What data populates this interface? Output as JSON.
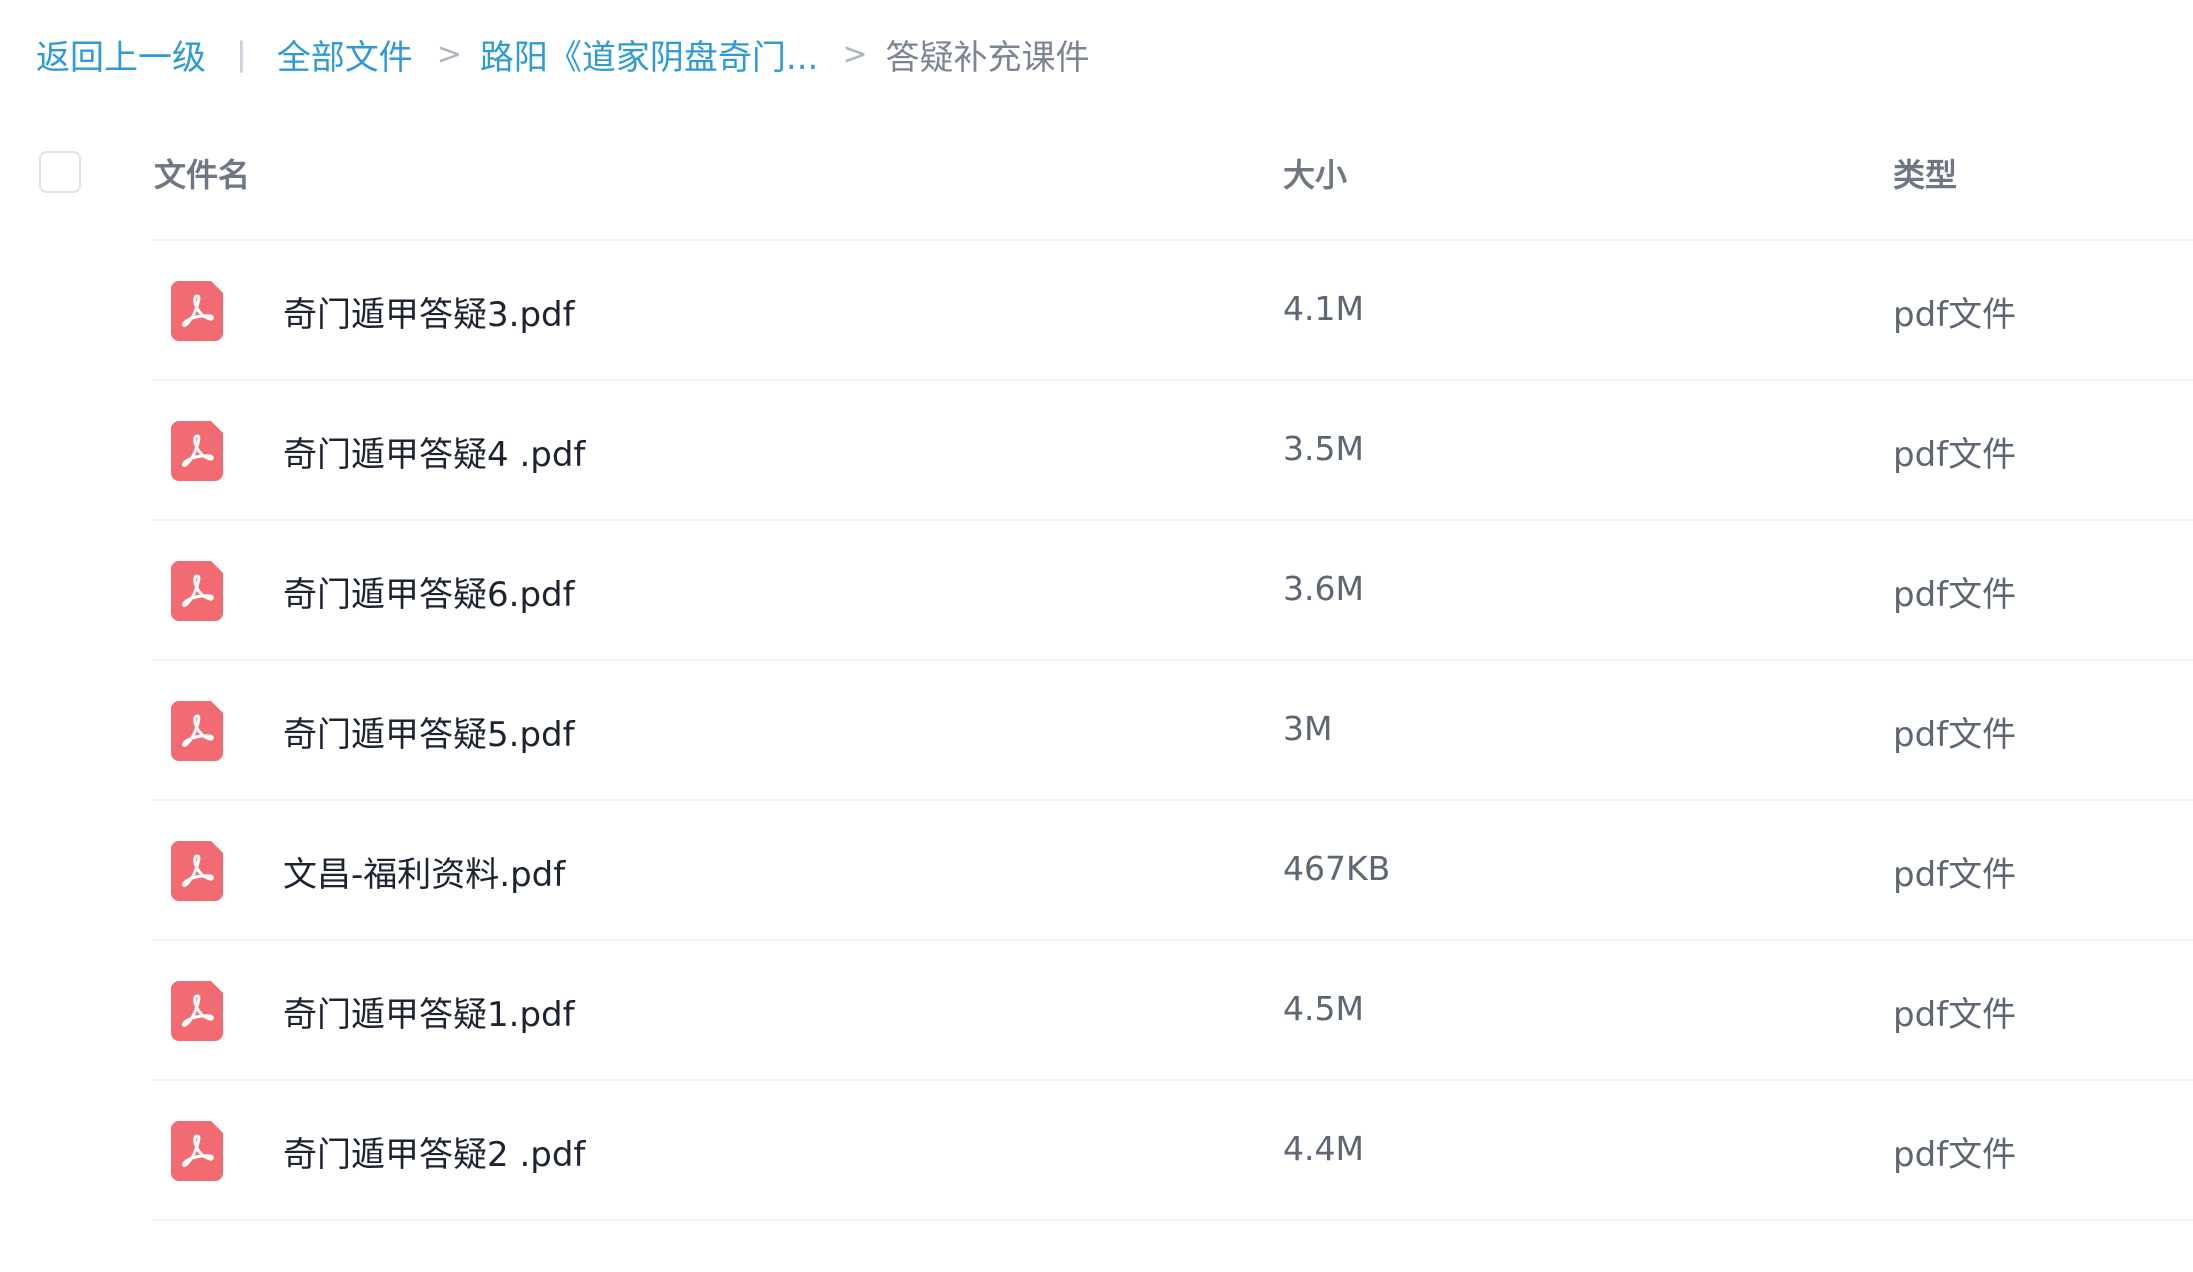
{
  "breadcrumb": {
    "back_label": "返回上一级",
    "divider": "|",
    "all_files_label": "全部文件",
    "separator": ">",
    "parent_label": "路阳《道家阴盘奇门...",
    "current_label": "答疑补充课件"
  },
  "table": {
    "headers": {
      "name": "文件名",
      "size": "大小",
      "type": "类型"
    },
    "rows": [
      {
        "name": "奇门遁甲答疑3.pdf",
        "size": "4.1M",
        "type": "pdf文件",
        "icon": "pdf-file-icon"
      },
      {
        "name": "奇门遁甲答疑4 .pdf",
        "size": "3.5M",
        "type": "pdf文件",
        "icon": "pdf-file-icon"
      },
      {
        "name": "奇门遁甲答疑6.pdf",
        "size": "3.6M",
        "type": "pdf文件",
        "icon": "pdf-file-icon"
      },
      {
        "name": "奇门遁甲答疑5.pdf",
        "size": "3M",
        "type": "pdf文件",
        "icon": "pdf-file-icon"
      },
      {
        "name": "文昌-福利资料.pdf",
        "size": "467KB",
        "type": "pdf文件",
        "icon": "pdf-file-icon"
      },
      {
        "name": "奇门遁甲答疑1.pdf",
        "size": "4.5M",
        "type": "pdf文件",
        "icon": "pdf-file-icon"
      },
      {
        "name": "奇门遁甲答疑2 .pdf",
        "size": "4.4M",
        "type": "pdf文件",
        "icon": "pdf-file-icon"
      }
    ]
  },
  "colors": {
    "link": "#2f9bd6",
    "pdf_icon": "#f26b72",
    "header_text": "#6f7784",
    "row_divider": "#eef0f3"
  }
}
